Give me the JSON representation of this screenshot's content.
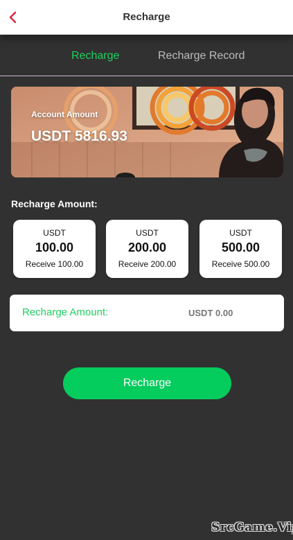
{
  "header": {
    "title": "Recharge",
    "back_icon": "chevron-left-icon",
    "accent_color": "#d0263c"
  },
  "tabs": [
    {
      "label": "Recharge",
      "active": true
    },
    {
      "label": "Recharge Record",
      "active": false
    }
  ],
  "account": {
    "label": "Account Amount",
    "balance": "USDT 5816.93"
  },
  "recharge": {
    "section_label": "Recharge Amount:",
    "options": [
      {
        "currency": "USDT",
        "amount": "100.00",
        "receive": "Receive 100.00"
      },
      {
        "currency": "USDT",
        "amount": "200.00",
        "receive": "Receive 200.00"
      },
      {
        "currency": "USDT",
        "amount": "500.00",
        "receive": "Receive 500.00"
      }
    ],
    "input_label": "Recharge Amount:",
    "input_value": "USDT 0.00",
    "submit_label": "Recharge"
  },
  "colors": {
    "background": "#313131",
    "accent_green": "#1ed15f",
    "button_green": "#04cc5d"
  },
  "watermark": "SrcGame.Vip"
}
